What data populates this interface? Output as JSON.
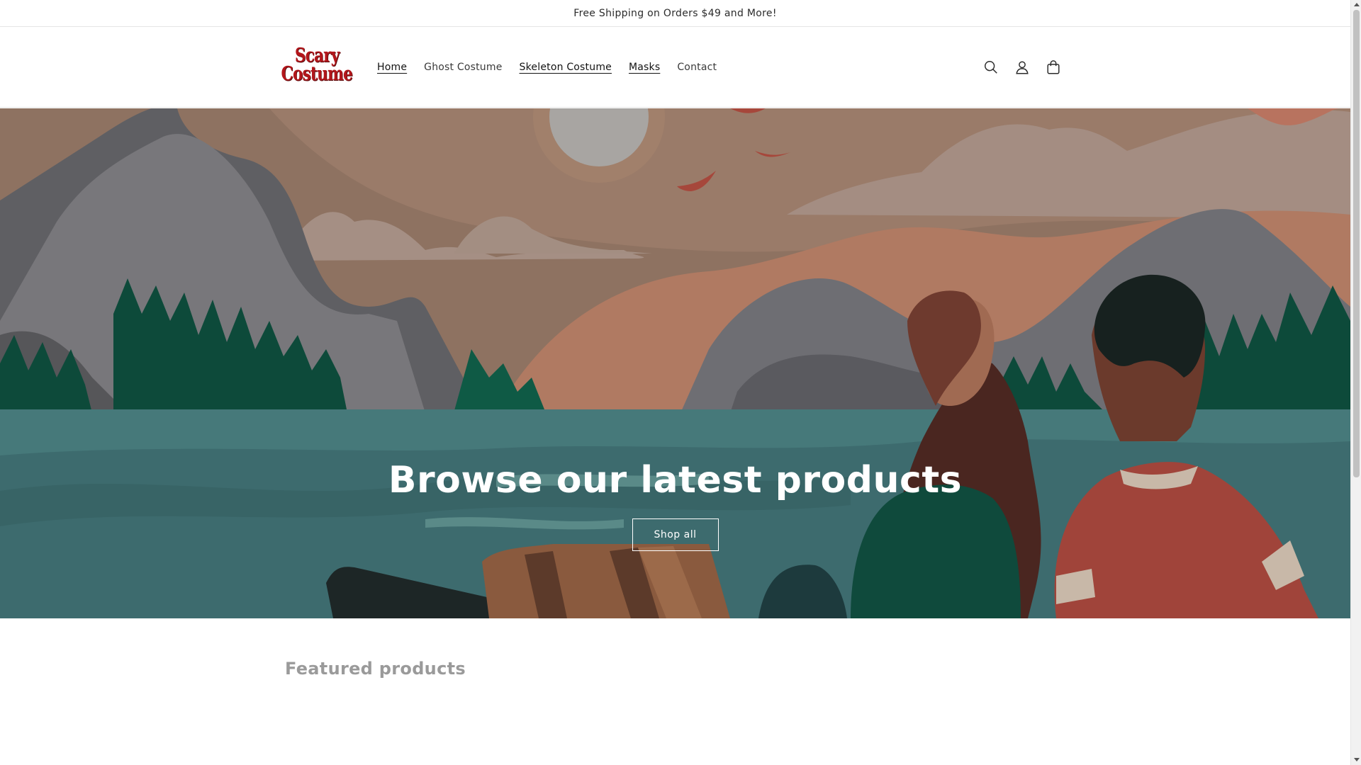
{
  "announcement": {
    "text": "Free Shipping on Orders $49 and More!"
  },
  "header": {
    "logo": {
      "line1": "Scary",
      "line2": "Costume",
      "color": "#b3161b"
    },
    "nav": [
      {
        "label": "Home",
        "active": true
      },
      {
        "label": "Ghost Costume",
        "active": false
      },
      {
        "label": "Skeleton Costume",
        "active": false
      },
      {
        "label": "Masks",
        "active": false
      },
      {
        "label": "Contact",
        "active": false
      }
    ],
    "icons": [
      "search-icon",
      "account-icon",
      "cart-icon"
    ]
  },
  "hero": {
    "title": "Browse our latest products",
    "button_label": "Shop all"
  },
  "featured": {
    "title": "Featured products"
  }
}
